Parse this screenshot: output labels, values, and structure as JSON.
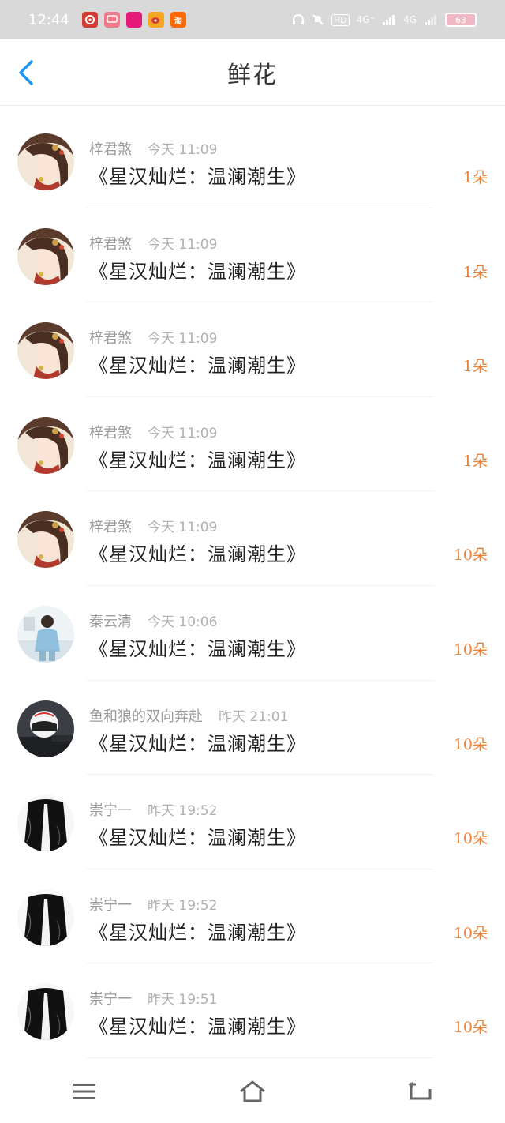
{
  "status_bar": {
    "time": "12:44",
    "app_icons": [
      "netease-music-icon",
      "message-icon",
      "app-icon",
      "weibo-icon",
      "taobao-icon"
    ],
    "taobao_label": "淘",
    "network": "4G⁺",
    "network2": "4G",
    "hd": "HD",
    "battery": "63"
  },
  "header": {
    "title": "鲜花"
  },
  "items": [
    {
      "name": "梓君煞",
      "time": "今天 11:09",
      "book": "《星汉灿烂：温澜潮生》",
      "count": "1朵",
      "avatar": "portrait-girl"
    },
    {
      "name": "梓君煞",
      "time": "今天 11:09",
      "book": "《星汉灿烂：温澜潮生》",
      "count": "1朵",
      "avatar": "portrait-girl"
    },
    {
      "name": "梓君煞",
      "time": "今天 11:09",
      "book": "《星汉灿烂：温澜潮生》",
      "count": "1朵",
      "avatar": "portrait-girl"
    },
    {
      "name": "梓君煞",
      "time": "今天 11:09",
      "book": "《星汉灿烂：温澜潮生》",
      "count": "1朵",
      "avatar": "portrait-girl"
    },
    {
      "name": "梓君煞",
      "time": "今天 11:09",
      "book": "《星汉灿烂：温澜潮生》",
      "count": "10朵",
      "avatar": "portrait-girl"
    },
    {
      "name": "秦云清",
      "time": "今天 10:06",
      "book": "《星汉灿烂：温澜潮生》",
      "count": "10朵",
      "avatar": "photo-boy"
    },
    {
      "name": "鱼和狼的双向奔赴",
      "time": "昨天 21:01",
      "book": "《星汉灿烂：温澜潮生》",
      "count": "10朵",
      "avatar": "helmet"
    },
    {
      "name": "崇宁一",
      "time": "昨天 19:52",
      "book": "《星汉灿烂：温澜潮生》",
      "count": "10朵",
      "avatar": "dark-figure"
    },
    {
      "name": "崇宁一",
      "time": "昨天 19:52",
      "book": "《星汉灿烂：温澜潮生》",
      "count": "10朵",
      "avatar": "dark-figure"
    },
    {
      "name": "崇宁一",
      "time": "昨天 19:51",
      "book": "《星汉灿烂：温澜潮生》",
      "count": "10朵",
      "avatar": "dark-figure"
    }
  ],
  "bottom_nav": {
    "buttons": [
      "menu-icon",
      "home-icon",
      "back-icon"
    ]
  },
  "colors": {
    "accent": "#2196f3",
    "count": "#e9823a"
  }
}
